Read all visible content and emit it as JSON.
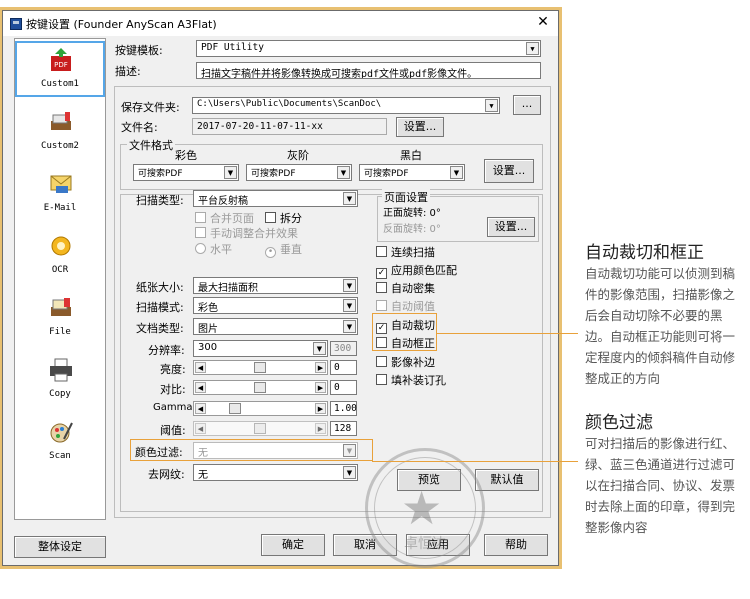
{
  "window": {
    "title": "按键设置 (Founder AnyScan A3Flat)",
    "close": "✕"
  },
  "sidebar": {
    "items": [
      {
        "label": "Custom1",
        "icon": "pdf-icon"
      },
      {
        "label": "Custom2",
        "icon": "scanner-icon"
      },
      {
        "label": "E-Mail",
        "icon": "mail-icon"
      },
      {
        "label": "OCR",
        "icon": "ocr-icon"
      },
      {
        "label": "File",
        "icon": "file-icon"
      },
      {
        "label": "Copy",
        "icon": "printer-icon"
      },
      {
        "label": "Scan",
        "icon": "scan-icon"
      }
    ]
  },
  "header": {
    "template_label": "按键模板:",
    "template_value": "PDF Utility",
    "desc_label": "描述:",
    "desc_value": "扫描文字稿件并将影像转换成可搜索pdf文件或pdf影像文件。"
  },
  "save": {
    "folder_label": "保存文件夹:",
    "folder_value": "C:\\Users\\Public\\Documents\\ScanDoc\\",
    "browse": "...",
    "filename_label": "文件名:",
    "filename_value": "2017-07-20-11-07-11-xx",
    "filename_btn": "设置...",
    "format_title": "文件格式",
    "color_label": "彩色",
    "gray_label": "灰阶",
    "bw_label": "黑白",
    "color_value": "可搜索PDF",
    "gray_value": "可搜索PDF",
    "bw_value": "可搜索PDF",
    "format_btn": "设置..."
  },
  "scan": {
    "type_label": "扫描类型:",
    "type_value": "平台反射稿",
    "merge": "合并页面",
    "split": "拆分",
    "manual": "手动调整合并效果",
    "horizontal": "水平",
    "vertical": "垂直",
    "paper_label": "纸张大小:",
    "paper_value": "最大扫描面积",
    "mode_label": "扫描模式:",
    "mode_value": "彩色",
    "doctype_label": "文档类型:",
    "doctype_value": "图片",
    "dpi_label": "分辨率:",
    "dpi_value": "300",
    "dpi_value2": "300",
    "brightness_label": "亮度:",
    "brightness_value": "0",
    "contrast_label": "对比:",
    "contrast_value": "0",
    "gamma_label": "Gamma:",
    "gamma_value": "1.00",
    "threshold_label": "阈值:",
    "threshold_value": "128",
    "colorfilter_label": "颜色过滤:",
    "colorfilter_value": "无",
    "descreen_label": "去网纹:",
    "descreen_value": "无"
  },
  "page_settings": {
    "title": "页面设置",
    "front": "正面旋转: 0°",
    "back": "反面旋转: 0°",
    "btn": "设置..."
  },
  "options": {
    "continuous": "连续扫描",
    "color_match": "应用颜色匹配",
    "auto_density": "自动密集",
    "auto_threshold": "自动阈值",
    "auto_crop": "自动裁切",
    "auto_deskew": "自动框正",
    "image_fill": "影像补边",
    "fill_binding": "填补装订孔"
  },
  "buttons": {
    "preview": "预览",
    "default": "默认值",
    "global": "整体设定",
    "ok": "确定",
    "cancel": "取消",
    "apply": "应用",
    "help": "帮助"
  },
  "annotations": {
    "crop_title": "自动裁切和框正",
    "crop_body": "自动裁切功能可以侦测到稿件的影像范围，扫描影像之后会自动切除不必要的黑边。自动框正功能则可将一定程度内的倾斜稿件自动修整成正的方向",
    "filter_title": "颜色过滤",
    "filter_body": "可对扫描后的影像进行红、绿、蓝三色通道进行过滤可以在扫描合同、协议、发票时去除上面的印章，得到完整影像内容"
  },
  "stamp": {
    "text": "卓恒达"
  },
  "colors": {
    "highlight": "#e8a13b",
    "frame": "#e8c071"
  }
}
